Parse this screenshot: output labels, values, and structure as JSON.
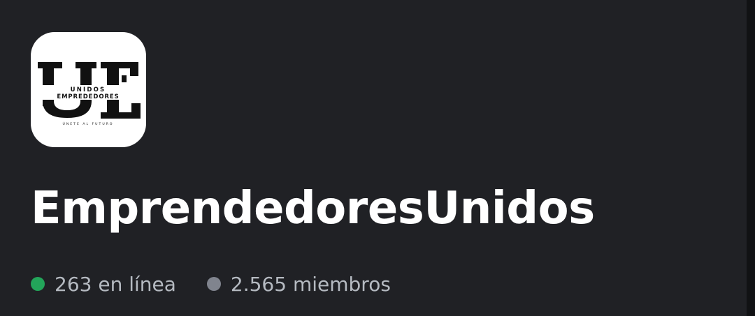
{
  "server": {
    "name": "EmprendedoresUnidos",
    "logo": {
      "monogram": "UE",
      "line1": "UNIDOS",
      "line2": "EMPREDEDORES",
      "tagline": "ÚNETE AL FUTURO"
    }
  },
  "stats": {
    "online": {
      "text": "263 en línea",
      "color": "#23a55a"
    },
    "members": {
      "text": "2.565 miembros",
      "color": "#80848e"
    }
  },
  "colors": {
    "background": "#202125",
    "edge": "#111214",
    "title": "#ffffff",
    "secondary_text": "#b5bac1"
  }
}
